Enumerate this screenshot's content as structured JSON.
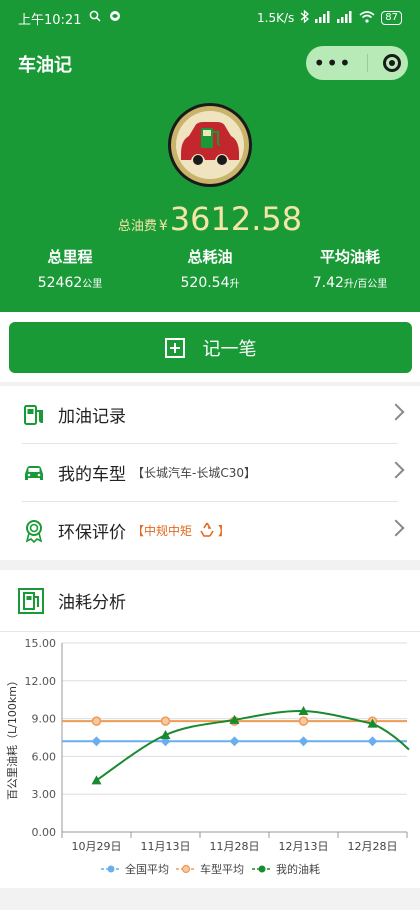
{
  "status_bar": {
    "time": "上午10:21",
    "speed": "1.5K/s",
    "battery": "87"
  },
  "app": {
    "title": "车油记"
  },
  "summary": {
    "total_cost_label": "总油费",
    "currency": "¥",
    "total_cost": "3612.58",
    "stats": [
      {
        "label": "总里程",
        "value": "52462",
        "unit": "公里"
      },
      {
        "label": "总耗油",
        "value": "520.54",
        "unit": "升"
      },
      {
        "label": "平均油耗",
        "value": "7.42",
        "unit": "升/百公里"
      }
    ]
  },
  "record_button": {
    "label": "记一笔"
  },
  "menu": {
    "items": [
      {
        "label": "加油记录",
        "icon": "fuel-pump-icon"
      },
      {
        "label": "我的车型",
        "sub": "【长城汽车-长城C30】",
        "icon": "car-icon"
      },
      {
        "label": "环保评价",
        "eval_prefix": "【",
        "eval": "中规中矩",
        "eval_suffix": "】",
        "icon": "badge-icon"
      }
    ]
  },
  "analysis": {
    "title": "油耗分析"
  },
  "colors": {
    "brand": "#1a9a37",
    "national": "#6aaef0",
    "model": "#ef9a55",
    "mine": "#1a8a2e"
  },
  "chart_data": {
    "type": "line",
    "categories": [
      "10月29日",
      "11月13日",
      "11月28日",
      "12月13日",
      "12月28日"
    ],
    "ylabel": "百公里油耗（L/100km）",
    "ylim": [
      0,
      15
    ],
    "yticks": [
      "0.00",
      "3.00",
      "6.00",
      "9.00",
      "12.00",
      "15.00"
    ],
    "series": [
      {
        "name": "全国平均",
        "values": [
          7.2,
          7.2,
          7.2,
          7.2,
          7.2
        ]
      },
      {
        "name": "车型平均",
        "values": [
          8.8,
          8.8,
          8.8,
          8.8,
          8.8
        ]
      },
      {
        "name": "我的油耗",
        "values": [
          4.1,
          7.7,
          8.9,
          9.6,
          8.6
        ]
      }
    ],
    "legend_position": "bottom",
    "grid": true
  }
}
